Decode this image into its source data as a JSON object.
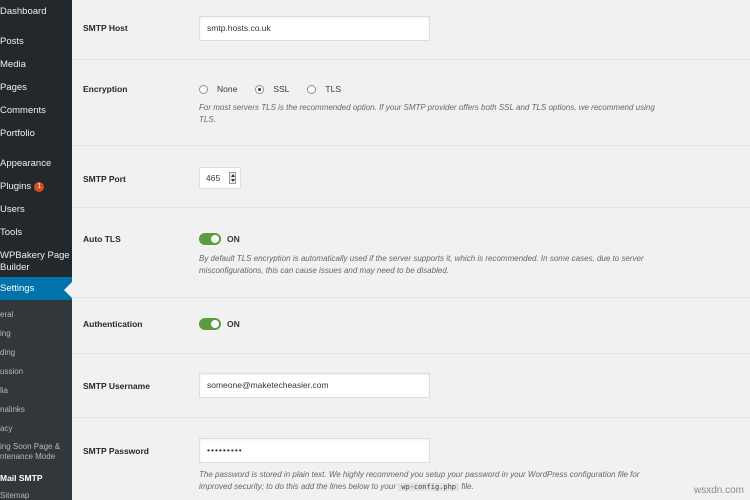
{
  "sidebar": {
    "items": [
      {
        "label": "Dashboard"
      },
      {
        "label": "Posts"
      },
      {
        "label": "Media"
      },
      {
        "label": "Pages"
      },
      {
        "label": "Comments"
      },
      {
        "label": "Portfolio"
      },
      {
        "label": "Appearance"
      },
      {
        "label": "Plugins",
        "badge": "1"
      },
      {
        "label": "Users"
      },
      {
        "label": "Tools"
      },
      {
        "label": "WPBakery Page",
        "label2": "Builder"
      },
      {
        "label": "Settings"
      }
    ],
    "submenu": [
      {
        "label": "eral"
      },
      {
        "label": "ing"
      },
      {
        "label": "ding"
      },
      {
        "label": "ussion"
      },
      {
        "label": "lia"
      },
      {
        "label": "nalinks"
      },
      {
        "label": "acy"
      },
      {
        "label": "ing Soon Page &",
        "label2": "ntenance Mode"
      },
      {
        "label": "Mail SMTP"
      },
      {
        "label": "Sitemap"
      }
    ]
  },
  "form": {
    "smtp_host": {
      "label": "SMTP Host",
      "value": "smtp.hosts.co.uk"
    },
    "encryption": {
      "label": "Encryption",
      "options": [
        "None",
        "SSL",
        "TLS"
      ],
      "selected": "SSL",
      "description": "For most servers TLS is the recommended option. If your SMTP provider offers both SSL and TLS options, we recommend using",
      "description2": "TLS."
    },
    "smtp_port": {
      "label": "SMTP Port",
      "value": "465"
    },
    "auto_tls": {
      "label": "Auto TLS",
      "state": "ON",
      "description": "By default TLS encryption is automatically used if the server supports it, which is recommended. In some cases, due to server",
      "description2": "misconfigurations, this can cause issues and may need to be disabled."
    },
    "authentication": {
      "label": "Authentication",
      "state": "ON"
    },
    "smtp_username": {
      "label": "SMTP Username",
      "value": "someone@maketecheasier.com"
    },
    "smtp_password": {
      "label": "SMTP Password",
      "value": "•••••••••",
      "description": "The password is stored in plain text. We highly recommend you setup your password in your WordPress configuration file for",
      "description2a": "improved security; to do this add the lines below to your",
      "code": "wp-config.php",
      "description2b": "file."
    }
  },
  "watermark": "wsxdn.com",
  "colors": {
    "sidebar_bg": "#23282d",
    "active": "#0073aa",
    "toggle_on": "#5b9c3f"
  }
}
